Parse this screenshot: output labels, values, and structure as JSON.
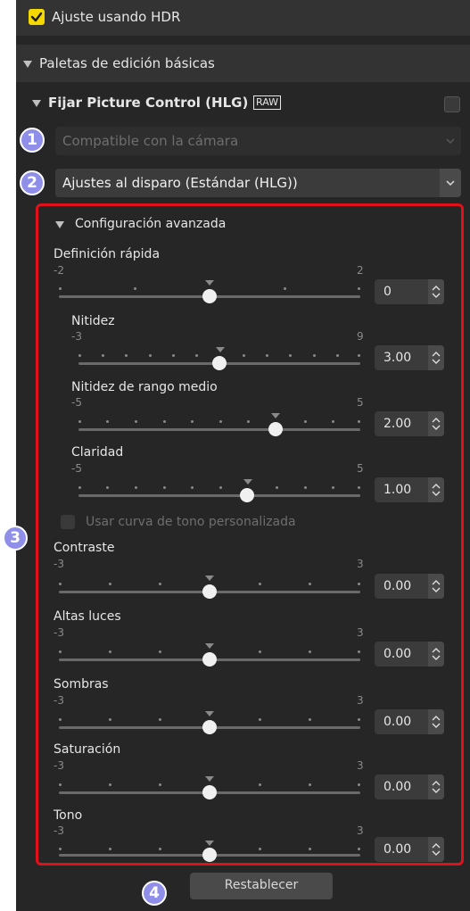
{
  "hdr_toggle": {
    "label": "Ajuste usando HDR",
    "checked": true
  },
  "basic_palettes": {
    "label": "Paletas de edición básicas"
  },
  "picture_control": {
    "label": "Fijar Picture Control (HLG)",
    "raw_badge": "RAW",
    "checked": false
  },
  "compat_select": {
    "value": "Compatible con la cámara",
    "disabled": true
  },
  "shooting_select": {
    "value": "Ajustes al disparo (Estándar (HLG))"
  },
  "advanced": {
    "label": "Configuración avanzada"
  },
  "tone_curve": {
    "label": "Usar curva de tono personalizada",
    "disabled": true
  },
  "sliders": {
    "quick": {
      "label": "Definición rápida",
      "min": "-2",
      "max": "2",
      "value": "0",
      "position": 0.5
    },
    "sharpness": {
      "label": "Nitidez",
      "min": "-3",
      "max": "9",
      "value": "3.00",
      "position": 0.5
    },
    "midrange": {
      "label": "Nitidez de rango medio",
      "min": "-5",
      "max": "5",
      "value": "2.00",
      "position": 0.7
    },
    "clarity": {
      "label": "Claridad",
      "min": "-5",
      "max": "5",
      "value": "1.00",
      "position": 0.6
    },
    "contrast": {
      "label": "Contraste",
      "min": "-3",
      "max": "3",
      "value": "0.00",
      "position": 0.5
    },
    "highlights": {
      "label": "Altas luces",
      "min": "-3",
      "max": "3",
      "value": "0.00",
      "position": 0.5
    },
    "shadows": {
      "label": "Sombras",
      "min": "-3",
      "max": "3",
      "value": "0.00",
      "position": 0.5
    },
    "saturation": {
      "label": "Saturación",
      "min": "-3",
      "max": "3",
      "value": "0.00",
      "position": 0.5
    },
    "hue": {
      "label": "Tono",
      "min": "-3",
      "max": "3",
      "value": "0.00",
      "position": 0.5
    }
  },
  "reset_button": {
    "label": "Restablecer"
  },
  "callouts": {
    "c1": "1",
    "c2": "2",
    "c3": "3",
    "c4": "4"
  },
  "colors": {
    "accent_yellow": "#f5d800",
    "highlight_red": "#e0111b",
    "callout_purple": "#8f8fea",
    "panel_bg": "#262626"
  }
}
